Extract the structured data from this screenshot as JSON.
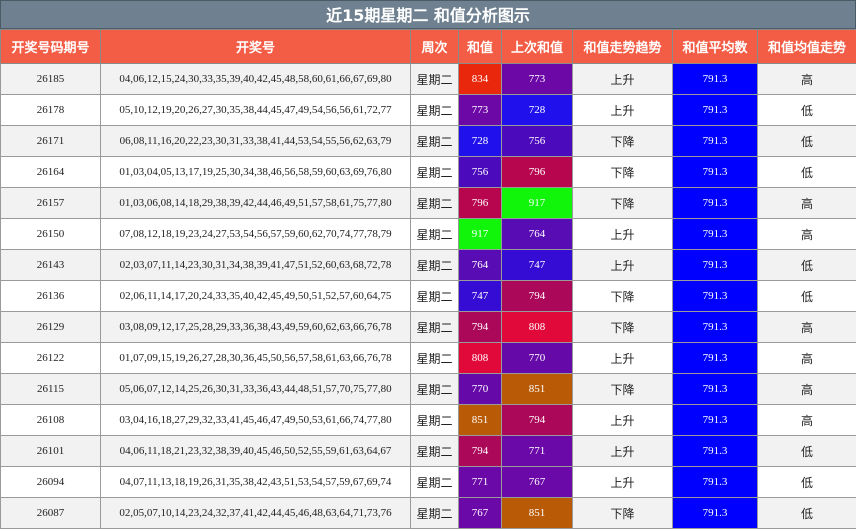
{
  "title": "近15期星期二 和值分析图示",
  "headers": [
    "开奖号码期号",
    "开奖号",
    "周次",
    "和值",
    "上次和值",
    "和值走势趋势",
    "和值平均数",
    "和值均值走势"
  ],
  "rows": [
    {
      "period": "26185",
      "numbers": "04,06,12,15,24,30,33,35,39,40,42,45,48,58,60,61,66,67,69,80",
      "week": "星期二",
      "sum": "834",
      "sum_color": "#e8270c",
      "prev": "773",
      "prev_color": "#6c08a6",
      "trend": "上升",
      "avg": "791.3",
      "dir": "高"
    },
    {
      "period": "26178",
      "numbers": "05,10,12,19,20,26,27,30,35,38,44,45,47,49,54,56,56,61,72,77",
      "week": "星期二",
      "sum": "773",
      "sum_color": "#6c08a6",
      "prev": "728",
      "prev_color": "#1f10ec",
      "trend": "上升",
      "avg": "791.3",
      "dir": "低"
    },
    {
      "period": "26171",
      "numbers": "06,08,11,16,20,22,23,30,31,33,38,41,44,53,54,55,56,62,63,79",
      "week": "星期二",
      "sum": "728",
      "sum_color": "#1f10ec",
      "prev": "756",
      "prev_color": "#4b0abb",
      "trend": "下降",
      "avg": "791.3",
      "dir": "低"
    },
    {
      "period": "26164",
      "numbers": "01,03,04,05,13,17,19,25,30,34,38,46,56,58,59,60,63,69,76,80",
      "week": "星期二",
      "sum": "756",
      "sum_color": "#4b0abb",
      "prev": "796",
      "prev_color": "#b8064e",
      "trend": "下降",
      "avg": "791.3",
      "dir": "低"
    },
    {
      "period": "26157",
      "numbers": "01,03,06,08,14,18,29,38,39,42,44,46,49,51,57,58,61,75,77,80",
      "week": "星期二",
      "sum": "796",
      "sum_color": "#b8064e",
      "prev": "917",
      "prev_color": "#11f50b",
      "trend": "下降",
      "avg": "791.3",
      "dir": "高"
    },
    {
      "period": "26150",
      "numbers": "07,08,12,18,19,23,24,27,53,54,56,57,59,60,62,70,74,77,78,79",
      "week": "星期二",
      "sum": "917",
      "sum_color": "#11f50b",
      "prev": "764",
      "prev_color": "#580cb4",
      "trend": "上升",
      "avg": "791.3",
      "dir": "高"
    },
    {
      "period": "26143",
      "numbers": "02,03,07,11,14,23,30,31,34,38,39,41,47,51,52,60,63,68,72,78",
      "week": "星期二",
      "sum": "764",
      "sum_color": "#580cb4",
      "prev": "747",
      "prev_color": "#350cd4",
      "trend": "上升",
      "avg": "791.3",
      "dir": "低"
    },
    {
      "period": "26136",
      "numbers": "02,06,11,14,17,20,24,33,35,40,42,45,49,50,51,52,57,60,64,75",
      "week": "星期二",
      "sum": "747",
      "sum_color": "#350cd4",
      "prev": "794",
      "prev_color": "#ac0859",
      "trend": "下降",
      "avg": "791.3",
      "dir": "低"
    },
    {
      "period": "26129",
      "numbers": "03,08,09,12,17,25,28,29,33,36,38,43,49,59,60,62,63,66,76,78",
      "week": "星期二",
      "sum": "794",
      "sum_color": "#ac0859",
      "prev": "808",
      "prev_color": "#e0093a",
      "trend": "下降",
      "avg": "791.3",
      "dir": "高"
    },
    {
      "period": "26122",
      "numbers": "01,07,09,15,19,26,27,28,30,36,45,50,56,57,58,61,63,66,76,78",
      "week": "星期二",
      "sum": "808",
      "sum_color": "#e0093a",
      "prev": "770",
      "prev_color": "#6509a8",
      "trend": "上升",
      "avg": "791.3",
      "dir": "高"
    },
    {
      "period": "26115",
      "numbers": "05,06,07,12,14,25,26,30,31,33,36,43,44,48,51,57,70,75,77,80",
      "week": "星期二",
      "sum": "770",
      "sum_color": "#6509a8",
      "prev": "851",
      "prev_color": "#b85a06",
      "trend": "下降",
      "avg": "791.3",
      "dir": "高"
    },
    {
      "period": "26108",
      "numbers": "03,04,16,18,27,29,32,33,41,45,46,47,49,50,53,61,66,74,77,80",
      "week": "星期二",
      "sum": "851",
      "sum_color": "#b85a06",
      "prev": "794",
      "prev_color": "#ac0859",
      "trend": "上升",
      "avg": "791.3",
      "dir": "高"
    },
    {
      "period": "26101",
      "numbers": "04,06,11,18,21,23,32,38,39,40,45,46,50,52,55,59,61,63,64,67",
      "week": "星期二",
      "sum": "794",
      "sum_color": "#ac0859",
      "prev": "771",
      "prev_color": "#6a08a8",
      "trend": "上升",
      "avg": "791.3",
      "dir": "低"
    },
    {
      "period": "26094",
      "numbers": "04,07,11,13,18,19,26,31,35,38,42,43,51,53,54,57,59,67,69,74",
      "week": "星期二",
      "sum": "771",
      "sum_color": "#6a08a8",
      "prev": "767",
      "prev_color": "#6b08a8",
      "trend": "上升",
      "avg": "791.3",
      "dir": "低"
    },
    {
      "period": "26087",
      "numbers": "02,05,07,10,14,23,24,32,37,41,42,44,45,46,48,63,64,71,73,76",
      "week": "星期二",
      "sum": "767",
      "sum_color": "#6b08a8",
      "prev": "851",
      "prev_color": "#b85a06",
      "trend": "下降",
      "avg": "791.3",
      "dir": "低"
    }
  ]
}
